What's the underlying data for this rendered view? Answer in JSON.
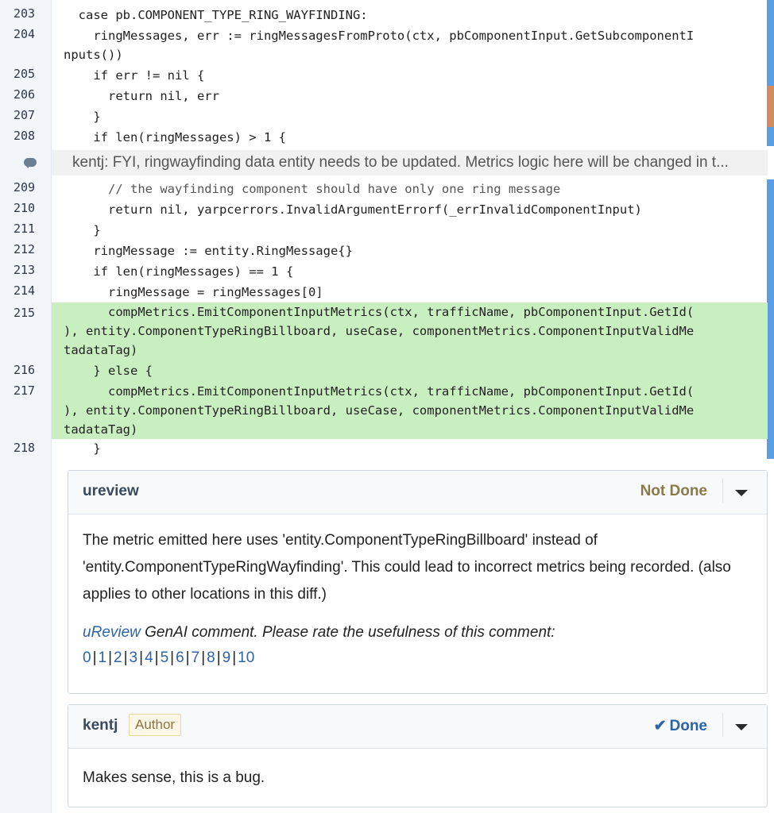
{
  "diff": {
    "lines": [
      {
        "num": "203",
        "code": "  case pb.COMPONENT_TYPE_RING_WAYFINDING:",
        "added": false
      },
      {
        "num": "204",
        "code": "    ringMessages, err := ringMessagesFromProto(ctx, pbComponentInput.GetSubcomponentI\nnputs())",
        "added": false
      },
      {
        "num": "205",
        "code": "    if err != nil {",
        "added": false
      },
      {
        "num": "206",
        "code": "      return nil, err",
        "added": false
      },
      {
        "num": "207",
        "code": "    }",
        "added": false
      },
      {
        "num": "208",
        "code": "    if len(ringMessages) > 1 {",
        "added": false
      },
      {
        "num": "209",
        "code": "      // the wayfinding component should have only one ring message",
        "added": false
      },
      {
        "num": "210",
        "code": "      return nil, yarpcerrors.InvalidArgumentErrorf(_errInvalidComponentInput)",
        "added": false
      },
      {
        "num": "211",
        "code": "    }",
        "added": false
      },
      {
        "num": "212",
        "code": "    ringMessage := entity.RingMessage{}",
        "added": false
      },
      {
        "num": "213",
        "code": "    if len(ringMessages) == 1 {",
        "added": false
      },
      {
        "num": "214",
        "code": "      ringMessage = ringMessages[0]",
        "added": false
      },
      {
        "num": "215",
        "code": "      compMetrics.EmitComponentInputMetrics(ctx, trafficName, pbComponentInput.GetId(\n), entity.ComponentTypeRingBillboard, useCase, componentMetrics.ComponentInputValidMe\ntadataTag)",
        "added": true
      },
      {
        "num": "216",
        "code": "    } else {",
        "added": true
      },
      {
        "num": "217",
        "code": "      compMetrics.EmitComponentInputMetrics(ctx, trafficName, pbComponentInput.GetId(\n), entity.ComponentTypeRingBillboard, useCase, componentMetrics.ComponentInputValidMe\ntadataTag)",
        "added": true
      },
      {
        "num": "218",
        "code": "    }",
        "added": false
      }
    ],
    "inline_comment": "kentj: FYI, ringwayfinding data entity needs to be updated. Metrics logic here will be changed in t..."
  },
  "comments": [
    {
      "author": "ureview",
      "status": "Not Done",
      "body": "The metric emitted here uses 'entity.ComponentTypeRingBillboard' instead of 'entity.ComponentTypeRingWayfinding'. This could lead to incorrect metrics being recorded. (also applies to other locations in this diff.)",
      "genai_link": "uReview",
      "genai_text": " GenAI comment. Please rate the usefulness of this comment:",
      "ratings": [
        "0",
        "1",
        "2",
        "3",
        "4",
        "5",
        "6",
        "7",
        "8",
        "9",
        "10"
      ]
    },
    {
      "author": "kentj",
      "badge": "Author",
      "status": "Done",
      "status_icon": "check-icon",
      "body": "Makes sense, this is a bug."
    }
  ],
  "colors": {
    "added_bg": "#c9efc1",
    "link": "#2d64a8",
    "not_done": "#8a7a4a",
    "done": "#2d64a8"
  }
}
